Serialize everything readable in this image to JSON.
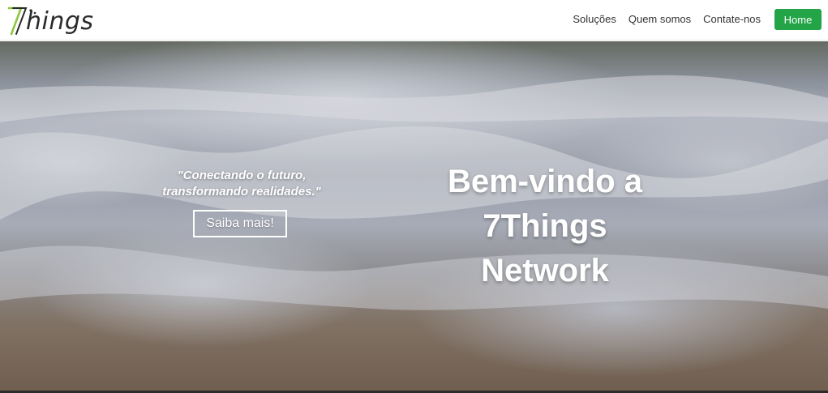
{
  "header": {
    "logo": {
      "text": "hings",
      "mark": "7",
      "accent_color": "#8dc63f"
    },
    "nav": {
      "links": [
        "Soluções",
        "Quem somos",
        "Contate-nos"
      ],
      "home_button": "Home",
      "home_button_color": "#22a447"
    }
  },
  "hero": {
    "tagline": "\"Conectando o futuro, transformando realidades.\"",
    "cta_label": "Saiba mais!",
    "headline": [
      "Bem-vindo a",
      "7Things",
      "Network"
    ]
  }
}
